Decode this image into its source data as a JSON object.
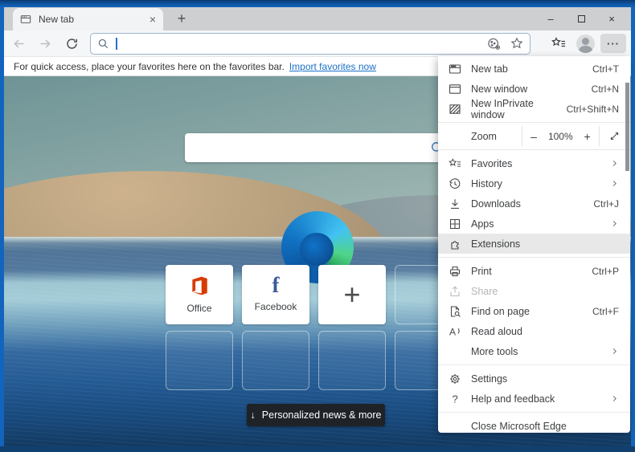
{
  "colors": {
    "frame_blue": "#1264bd",
    "tabstrip_gray": "#cdcfd1",
    "link_blue": "#1b70c6",
    "menu_highlight": "#e8e8e8",
    "news_button_bg": "#1f2328",
    "facebook_blue": "#3c5a99",
    "office_orange": "#d83b01",
    "search_icon_blue": "#3b7cc4"
  },
  "titlebar": {
    "tab_title": "New tab",
    "tab_close": "×",
    "new_tab_button": "+",
    "minimize": "–",
    "close": "×"
  },
  "toolbar": {
    "address_value": ""
  },
  "favorites_bar": {
    "message": "For quick access, place your favorites here on the favorites bar.",
    "link_label": "Import favorites now"
  },
  "new_tab_page": {
    "tiles": [
      {
        "label": "Office"
      },
      {
        "label": "Facebook"
      }
    ],
    "add_tile_glyph": "+",
    "facebook_glyph": "f",
    "news_button": {
      "arrow": "↓",
      "label": "Personalized news & more"
    }
  },
  "menu": {
    "section1": [
      {
        "label": "New tab",
        "shortcut": "Ctrl+T",
        "icon": "new-tab-icon"
      },
      {
        "label": "New window",
        "shortcut": "Ctrl+N",
        "icon": "new-window-icon"
      },
      {
        "label": "New InPrivate window",
        "shortcut": "Ctrl+Shift+N",
        "icon": "inprivate-icon"
      }
    ],
    "zoom": {
      "label": "Zoom",
      "minus": "–",
      "value": "100%",
      "plus": "+"
    },
    "section2": [
      {
        "label": "Favorites",
        "icon": "favorites-icon",
        "submenu": true
      },
      {
        "label": "History",
        "icon": "history-icon",
        "submenu": true
      },
      {
        "label": "Downloads",
        "shortcut": "Ctrl+J",
        "icon": "downloads-icon"
      },
      {
        "label": "Apps",
        "icon": "apps-icon",
        "submenu": true
      },
      {
        "label": "Extensions",
        "icon": "extensions-icon",
        "highlighted": true
      }
    ],
    "section3": [
      {
        "label": "Print",
        "shortcut": "Ctrl+P",
        "icon": "printer-icon"
      },
      {
        "label": "Share",
        "icon": "share-icon",
        "disabled": true
      },
      {
        "label": "Find on page",
        "shortcut": "Ctrl+F",
        "icon": "find-on-page-icon"
      },
      {
        "label": "Read aloud",
        "icon": "read-aloud-icon"
      },
      {
        "label": "More tools",
        "submenu": true
      }
    ],
    "section4": [
      {
        "label": "Settings",
        "icon": "settings-gear-icon"
      },
      {
        "label": "Help and feedback",
        "icon": "help-icon",
        "submenu": true
      }
    ],
    "section5": [
      {
        "label": "Close Microsoft Edge"
      }
    ]
  }
}
